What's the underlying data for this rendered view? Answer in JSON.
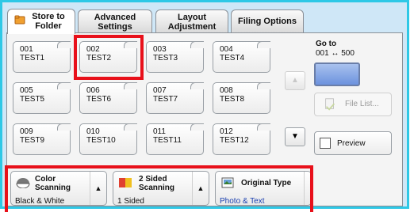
{
  "tabs": [
    {
      "label": "Store to Folder",
      "active": true
    },
    {
      "label": "Advanced Settings"
    },
    {
      "label": "Layout Adjustment"
    },
    {
      "label": "Filing Options"
    }
  ],
  "folders": [
    {
      "number": "001",
      "name": "TEST1"
    },
    {
      "number": "002",
      "name": "TEST2",
      "highlighted": true
    },
    {
      "number": "003",
      "name": "TEST3"
    },
    {
      "number": "004",
      "name": "TEST4"
    },
    {
      "number": "005",
      "name": "TEST5"
    },
    {
      "number": "006",
      "name": "TEST6"
    },
    {
      "number": "007",
      "name": "TEST7"
    },
    {
      "number": "008",
      "name": "TEST8"
    },
    {
      "number": "009",
      "name": "TEST9"
    },
    {
      "number": "010",
      "name": "TEST10"
    },
    {
      "number": "011",
      "name": "TEST11"
    },
    {
      "number": "012",
      "name": "TEST12"
    }
  ],
  "goto": {
    "label": "Go to",
    "range": "001 ↔ 500"
  },
  "file_list": {
    "label": "File List...",
    "enabled": false
  },
  "preview": {
    "label": "Preview",
    "checked": false
  },
  "scroll": {
    "up": "▲",
    "down": "▼"
  },
  "features": [
    {
      "title_line1": "Color",
      "title_line2": "Scanning",
      "value": "Black & White",
      "icon": "color-scanning-icon"
    },
    {
      "title_line1": "2 Sided",
      "title_line2": "Scanning",
      "value": "1 Sided",
      "icon": "two-sided-icon"
    },
    {
      "title_line1": "Original Type",
      "title_line2": "",
      "value": "Photo & Text",
      "icon": "original-type-icon"
    }
  ],
  "colors": {
    "frame": "#2ec8e6",
    "highlight": "#e8101a",
    "goto_button": "#6c92de",
    "value_blue": "#1a3fb0"
  }
}
